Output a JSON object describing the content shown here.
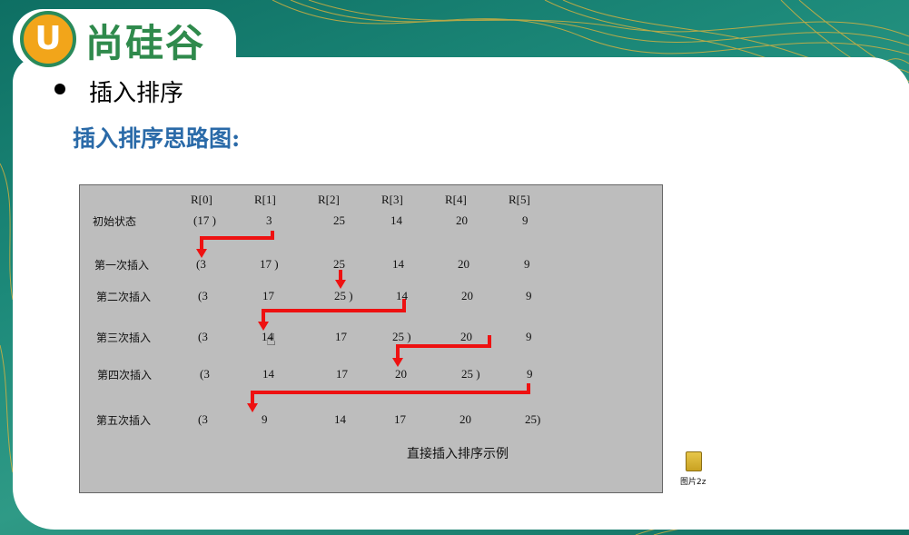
{
  "brand": {
    "logo_letter": "U",
    "logo_text": "尚硅谷"
  },
  "slide": {
    "bullet": "插入排序",
    "subheading": "插入排序思路图:"
  },
  "figure": {
    "headers": [
      "R[0]",
      "R[1]",
      "R[2]",
      "R[3]",
      "R[4]",
      "R[5]"
    ],
    "rows": [
      {
        "label": "初始状态",
        "cells": [
          "(17 )",
          "3",
          "25",
          "14",
          "20",
          "9"
        ]
      },
      {
        "label": "第一次插入",
        "cells": [
          "(3",
          "17 )",
          "25",
          "14",
          "20",
          "9"
        ]
      },
      {
        "label": "第二次插入",
        "cells": [
          "(3",
          "17",
          "25 )",
          "14",
          "20",
          "9"
        ]
      },
      {
        "label": "第三次插入",
        "cells": [
          "(3",
          "14",
          "17",
          "25 )",
          "20",
          "9"
        ]
      },
      {
        "label": "第四次插入",
        "cells": [
          "(3",
          "14",
          "17",
          "20",
          "25 )",
          "9"
        ]
      },
      {
        "label": "第五次插入",
        "cells": [
          "(3",
          "9",
          "14",
          "17",
          "20",
          "25)"
        ]
      }
    ],
    "caption": "直接插入排序示例",
    "arrow_color": "#ee1111"
  },
  "desktop_file": {
    "label": "图片2z",
    "icon": "folder-icon"
  },
  "colors": {
    "teal": "#1f7f72",
    "heading_blue": "#2a6aa8",
    "logo_green": "#2f8a4c",
    "logo_orange": "#f2a51a"
  }
}
